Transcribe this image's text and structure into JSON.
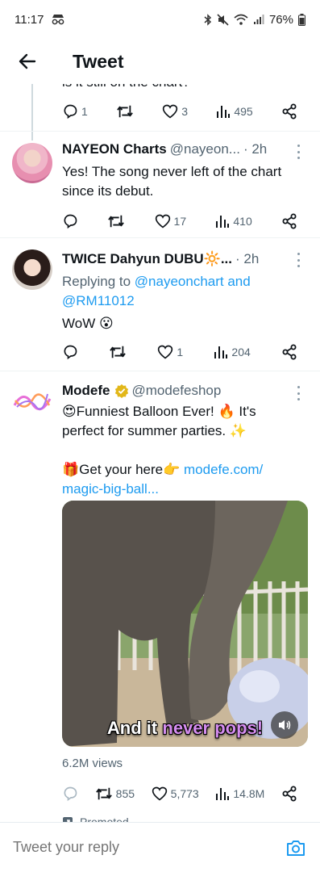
{
  "status_bar": {
    "time": "11:17",
    "battery": "76%"
  },
  "header": {
    "title": "Tweet"
  },
  "prev_tweet": {
    "cut_text": "is it still on the chart?",
    "replies": "1",
    "likes": "3",
    "views": "495"
  },
  "tweet1": {
    "name": "NAYEON Charts",
    "handle": "@nayeon...",
    "time": "· 2h",
    "text_line1": "Yes! The song never left of the chart",
    "text_line2": "since its debut.",
    "replies": "",
    "likes": "17",
    "views": "410"
  },
  "tweet2": {
    "name": "TWICE Dahyun DUBU🔆...",
    "time": "· 2h",
    "replying_prefix": "Replying to",
    "replying_to": "@nayeonchart and",
    "replying_to2": "@RM11012",
    "text": "WoW 😮",
    "replies": "",
    "likes": "1",
    "views": "204"
  },
  "ad_tweet": {
    "name": "Modefe",
    "handle": "@modefeshop",
    "line1_a": "😍Funniest Balloon Ever! 🔥 It's",
    "line1_b": "perfect for summer parties. ✨",
    "line2_a": "🎁Get your here👉",
    "line2_link": "modefe.com/",
    "line2_link2": "magic-big-ball...",
    "video_caption_a": "And it",
    "video_caption_b": "never pops!",
    "views_text": "6.2M views",
    "retweets": "855",
    "likes": "5,773",
    "view_count": "14.8M",
    "promoted": "Promoted"
  },
  "reply_bar": {
    "placeholder": "Tweet your reply"
  },
  "colors": {
    "accent": "#1d9bf0",
    "text": "#0f1419",
    "muted": "#536471",
    "verified": "#e2b719"
  }
}
